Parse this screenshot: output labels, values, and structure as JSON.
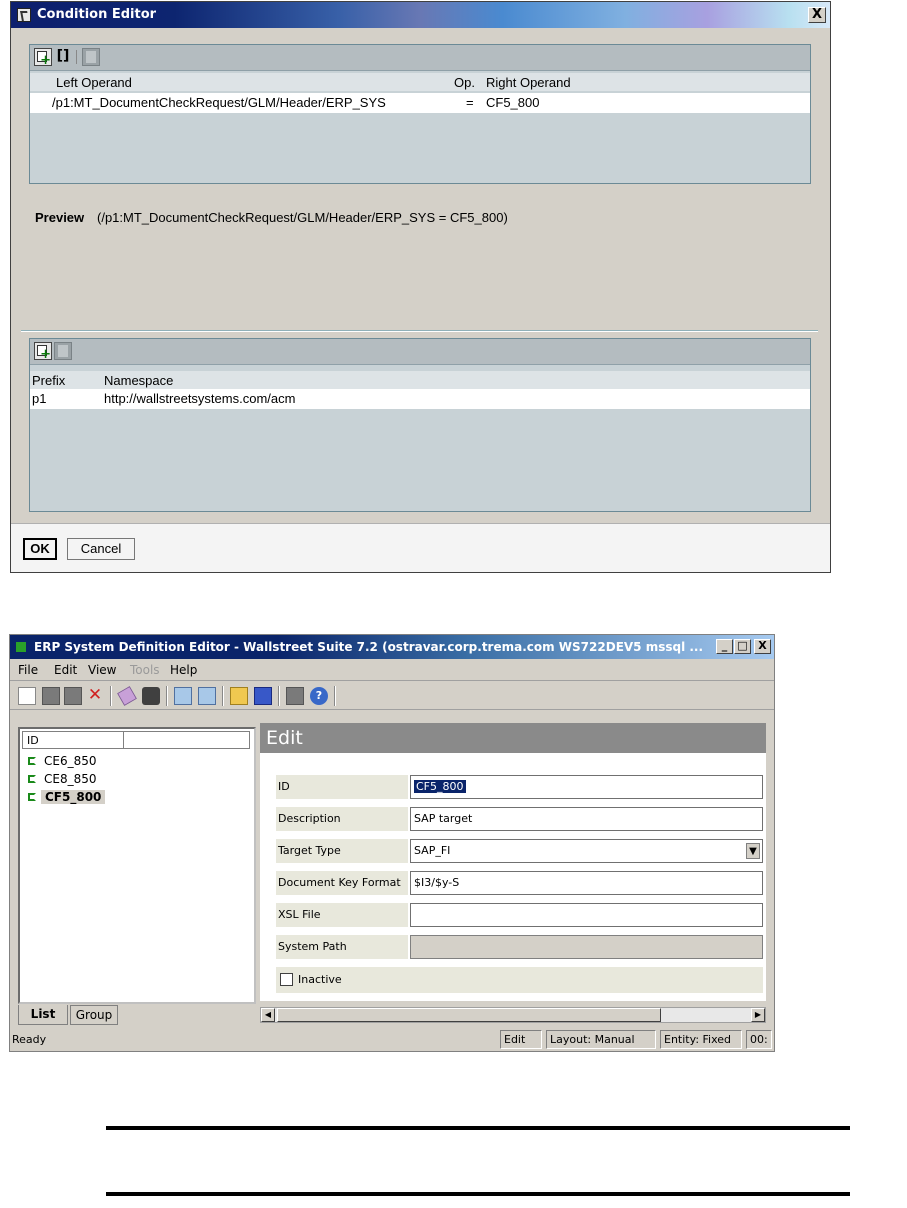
{
  "condition_editor": {
    "title": "Condition Editor",
    "close_label": "X",
    "conditions": {
      "headers": {
        "left": "Left Operand",
        "op": "Op.",
        "right": "Right Operand"
      },
      "rows": [
        {
          "left": "/p1:MT_DocumentCheckRequest/GLM/Header/ERP_SYS",
          "op": "=",
          "right": "CF5_800"
        }
      ]
    },
    "preview": {
      "label": "Preview",
      "value": "(/p1:MT_DocumentCheckRequest/GLM/Header/ERP_SYS = CF5_800)"
    },
    "namespaces": {
      "headers": {
        "prefix": "Prefix",
        "namespace": "Namespace"
      },
      "rows": [
        {
          "prefix": "p1",
          "namespace": "http://wallstreetsystems.com/acm"
        }
      ]
    },
    "buttons": {
      "ok": "OK",
      "cancel": "Cancel"
    }
  },
  "erp_editor": {
    "title": "ERP System Definition Editor - Wallstreet Suite 7.2 (ostravar.corp.trema.com  WS722DEV5 mssql ...",
    "window_buttons": {
      "minimize": "_",
      "maximize": "□",
      "close": "X"
    },
    "menu": [
      {
        "label": "File",
        "enabled": true
      },
      {
        "label": "Edit",
        "enabled": true
      },
      {
        "label": "View",
        "enabled": true
      },
      {
        "label": "Tools",
        "enabled": false
      },
      {
        "label": "Help",
        "enabled": true
      }
    ],
    "list": {
      "header": "ID",
      "items": [
        "CE6_850",
        "CE8_850",
        "CF5_800"
      ],
      "selected": "CF5_800"
    },
    "tabs": [
      "List",
      "Group"
    ],
    "edit_header": "Edit",
    "form": {
      "id_label": "ID",
      "id_value": "CF5_800",
      "description_label": "Description",
      "description_value": "SAP target",
      "target_type_label": "Target Type",
      "target_type_value": "SAP_FI",
      "doc_key_label": "Document Key Format",
      "doc_key_value": "$I3/$y-S",
      "xsl_label": "XSL File",
      "xsl_value": "",
      "system_path_label": "System Path",
      "system_path_value": "",
      "inactive_label": "Inactive",
      "inactive_checked": false
    },
    "status": {
      "ready": "Ready",
      "mode": "Edit",
      "layout": "Layout: Manual",
      "entity": "Entity: Fixed",
      "zoom": "00:"
    }
  }
}
